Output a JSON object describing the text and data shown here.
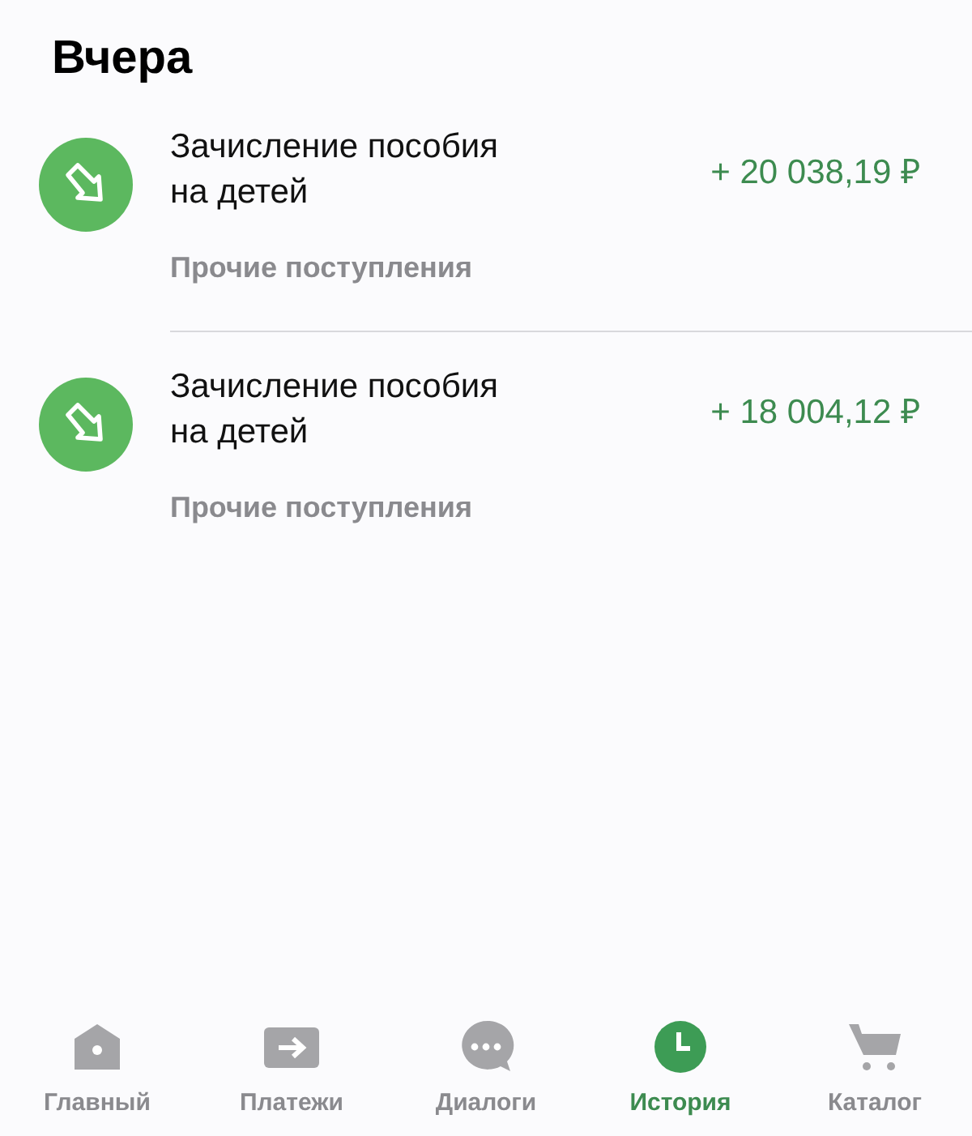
{
  "section_title": "Вчера",
  "transactions": [
    {
      "title": "Зачисление пособия на детей",
      "amount": "+ 20 038,19 ₽",
      "category": "Прочие поступления"
    },
    {
      "title": "Зачисление пособия на детей",
      "amount": "+ 18 004,12 ₽",
      "category": "Прочие поступления"
    }
  ],
  "tab_bar": [
    {
      "kind": "home",
      "label": "Главный",
      "selected": false
    },
    {
      "kind": "payments",
      "label": "Платежи",
      "selected": false
    },
    {
      "kind": "dialogs",
      "label": "Диалоги",
      "selected": false
    },
    {
      "kind": "history",
      "label": "История",
      "selected": true
    },
    {
      "kind": "catalog",
      "label": "Каталог",
      "selected": false
    }
  ]
}
